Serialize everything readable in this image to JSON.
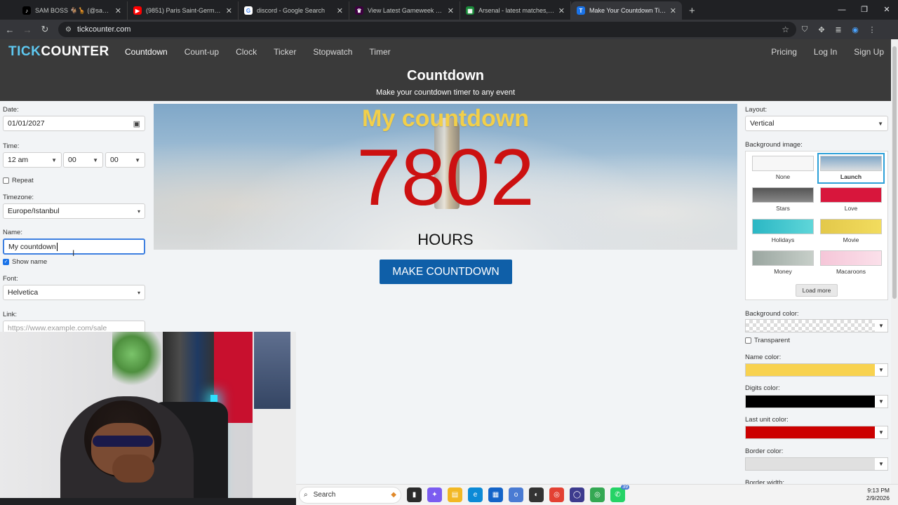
{
  "browser": {
    "tabs": [
      {
        "title": "SAM BOSS 🐐🦒 (@sam.boss3",
        "icon": "tiktok-icon",
        "color": "#000000"
      },
      {
        "title": "(9851) Paris Saint-Germain (5-0",
        "icon": "youtube-icon",
        "color": "#ff0000"
      },
      {
        "title": "discord - Google Search",
        "icon": "google-icon",
        "color": "#4285f4"
      },
      {
        "title": "View Latest Gameweek Points |",
        "icon": "premier-league-icon",
        "color": "#3d0040"
      },
      {
        "title": "Arsenal - latest matches, scores",
        "icon": "sheet-icon",
        "color": "#1b8a3a"
      },
      {
        "title": "Make Your Countdown Timer F",
        "icon": "tickcounter-icon",
        "color": "#1a73e8"
      }
    ],
    "url": "tickcounter.com"
  },
  "site": {
    "logo": {
      "tick": "TICK",
      "counter": "COUNTER"
    },
    "nav": [
      "Countdown",
      "Count-up",
      "Clock",
      "Ticker",
      "Stopwatch",
      "Timer"
    ],
    "nav_right": [
      "Pricing",
      "Log In",
      "Sign Up"
    ],
    "hero_title": "Countdown",
    "hero_subtitle": "Make your countdown timer to any event"
  },
  "form": {
    "date_label": "Date:",
    "date_value": "01/01/2027",
    "time_label": "Time:",
    "time_hour": "12 am",
    "time_min": "00",
    "time_sec": "00",
    "repeat_label": "Repeat",
    "timezone_label": "Timezone:",
    "timezone_value": "Europe/Istanbul",
    "name_label": "Name:",
    "name_value": "My countdown",
    "show_name_label": "Show name",
    "font_label": "Font:",
    "font_value": "Helvetica",
    "link_label": "Link:",
    "link_placeholder": "https://www.example.com/sale"
  },
  "preview": {
    "name": "My countdown",
    "digits": "7802",
    "unit": "HOURS",
    "make_button": "MAKE COUNTDOWN"
  },
  "settings": {
    "layout_label": "Layout:",
    "layout_value": "Vertical",
    "bg_image_label": "Background image:",
    "bg_images": [
      "None",
      "Launch",
      "Stars",
      "Love",
      "Holidays",
      "Movie",
      "Money",
      "Macaroons"
    ],
    "selected_bg": "Launch",
    "load_more": "Load more",
    "bg_color_label": "Background color:",
    "transparent_label": "Transparent",
    "name_color_label": "Name color:",
    "name_color": "#f8d24f",
    "digits_color_label": "Digits color:",
    "digits_color": "#000000",
    "last_unit_color_label": "Last unit color:",
    "last_unit_color": "#cc0000",
    "border_color_label": "Border color:",
    "border_color": "#e0e0e0",
    "border_width_label": "Border width:"
  },
  "taskbar": {
    "search": "Search",
    "time": "9:13 PM",
    "date": "2/9/2026",
    "badge": "39"
  }
}
